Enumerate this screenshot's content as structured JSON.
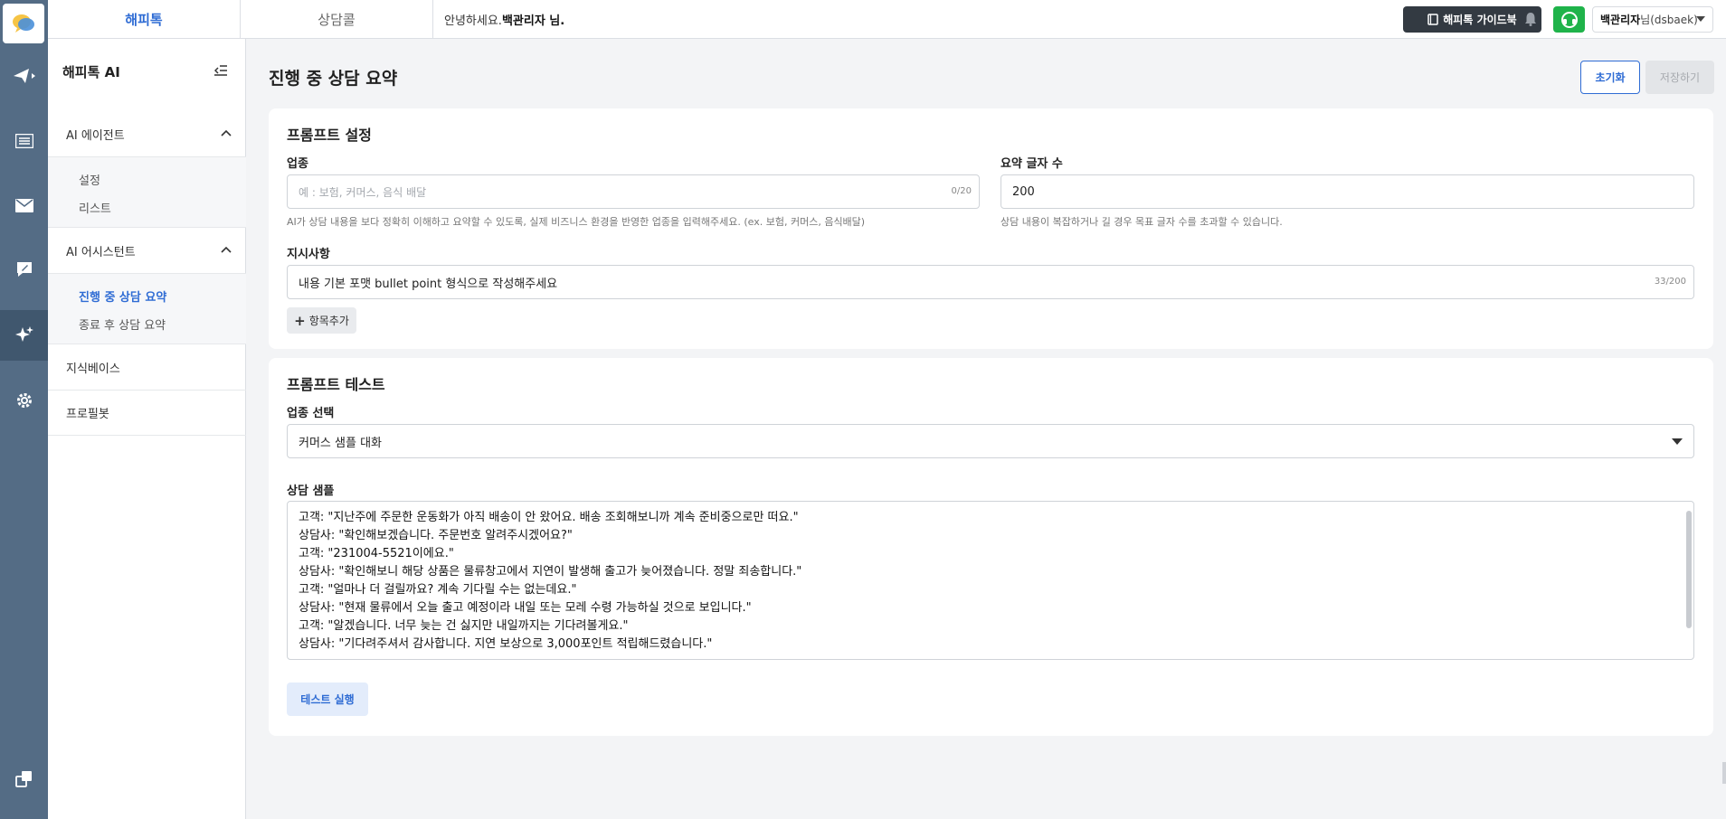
{
  "topbar": {
    "tab_happytalk": "해피톡",
    "tab_consult_call": "상담콜",
    "greeting_prefix": "안녕하세요.",
    "greeting_name": "백관리자 님.",
    "guide_button": "해피톡 가이드북",
    "user_name": "백관리자",
    "user_suffix": "님(dsbaek)"
  },
  "sidebar": {
    "title": "해피톡 AI",
    "sections": [
      {
        "label": "AI 에이전트",
        "items": [
          "설정",
          "리스트"
        ]
      },
      {
        "label": "AI 어시스턴트",
        "items": [
          "진행 중 상담 요약",
          "종료 후 상담 요약"
        ],
        "active": "진행 중 상담 요약"
      },
      {
        "label": "지식베이스"
      },
      {
        "label": "프로필봇"
      }
    ]
  },
  "main": {
    "title": "진행 중 상담 요약",
    "reset_button": "초기화",
    "save_button": "저장하기",
    "prompt_settings": {
      "title": "프롬프트 설정",
      "industry_label": "업종",
      "industry_placeholder": "예 : 보험, 커머스, 음식 배달",
      "industry_counter": "0/20",
      "industry_help": "AI가 상담 내용을 보다 정확히 이해하고 요약할 수 있도록, 실제 비즈니스 환경을 반영한 업종을 입력해주세요. (ex. 보험, 커머스, 음식배달)",
      "length_label": "요약 글자 수",
      "length_value": "200",
      "length_help": "상담 내용이 복잡하거나 길 경우 목표 글자 수를 초과할 수 있습니다.",
      "instruction_label": "지시사항",
      "instruction_value": "내용 기본 포맷 bullet point 형식으로 작성해주세요",
      "instruction_counter": "33/200",
      "add_item_button": "항목추가"
    },
    "prompt_test": {
      "title": "프롬프트 테스트",
      "industry_select_label": "업종 선택",
      "industry_selected": "커머스 샘플 대화",
      "sample_label": "상담 샘플",
      "sample_lines": [
        "고객: \"지난주에 주문한 운동화가 아직 배송이 안 왔어요. 배송 조회해보니까 계속 준비중으로만 떠요.\"",
        "상담사: \"확인해보겠습니다. 주문번호 알려주시겠어요?\"",
        "고객: \"231004-5521이에요.\"",
        "상담사: \"확인해보니 해당 상품은 물류창고에서 지연이 발생해 출고가 늦어졌습니다. 정말 죄송합니다.\"",
        "고객: \"얼마나 더 걸릴까요? 계속 기다릴 수는 없는데요.\"",
        "상담사: \"현재 물류에서 오늘 출고 예정이라 내일 또는 모레 수령 가능하실 것으로 보입니다.\"",
        "고객: \"알겠습니다. 너무 늦는 건 싫지만 내일까지는 기다려볼게요.\"",
        "상담사: \"기다려주셔서 감사합니다. 지연 보상으로 3,000포인트 적립해드렸습니다.\""
      ],
      "run_button": "테스트 실행"
    }
  },
  "colors": {
    "accent": "#2f6cd4",
    "rail": "#546c85",
    "support_green": "#1fb34a"
  }
}
